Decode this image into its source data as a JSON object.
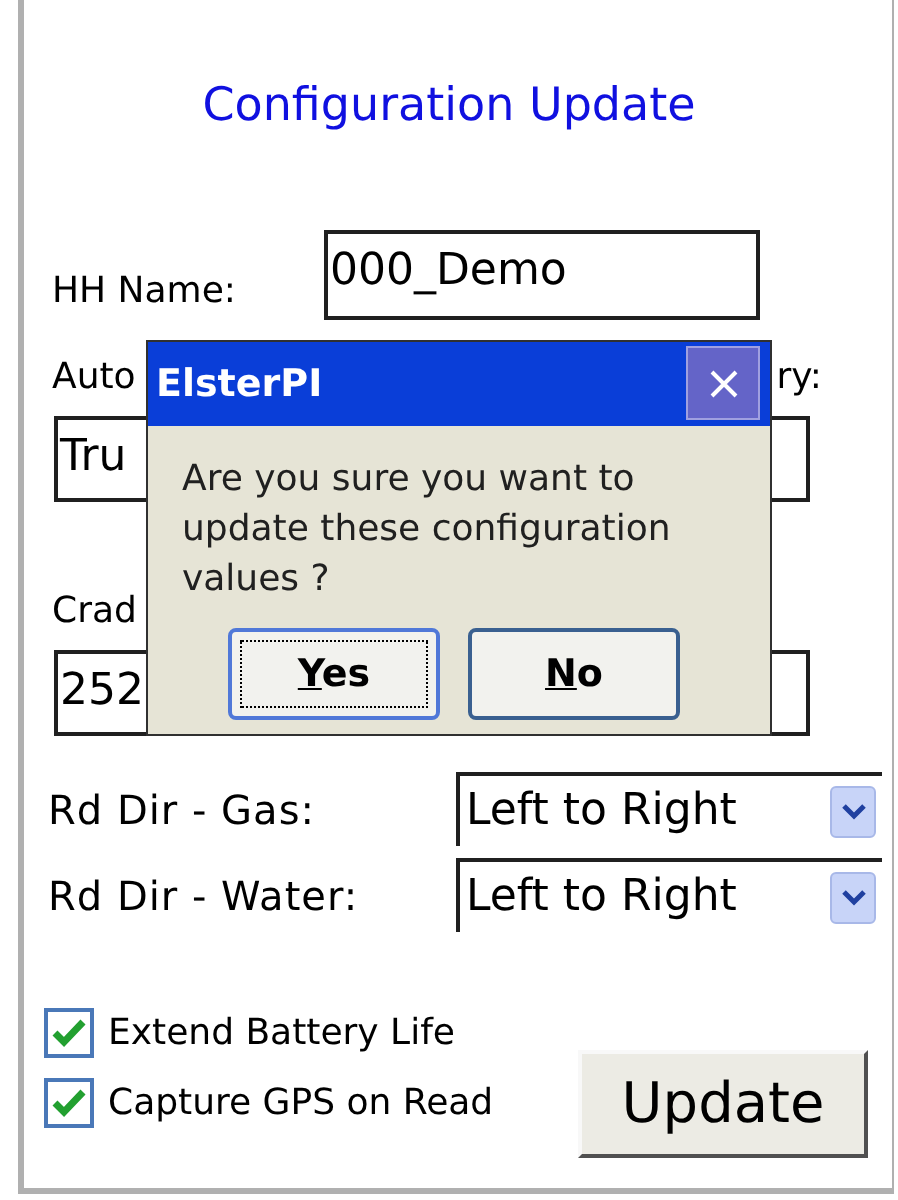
{
  "title": "Configuration Update",
  "hh_name": {
    "label": "HH Name:",
    "value": "000_Demo"
  },
  "fields": [
    {
      "label_left": "Auto",
      "label_right": "ry:",
      "value": "Tru"
    },
    {
      "label_left": "Crad",
      "value": "252"
    }
  ],
  "combos": [
    {
      "label": "Rd Dir - Gas:",
      "value": "Left to Right"
    },
    {
      "label": "Rd Dir - Water:",
      "value": "Left to Right"
    }
  ],
  "checkboxes": [
    {
      "label": "Extend Battery Life",
      "checked": true
    },
    {
      "label": "Capture GPS on Read",
      "checked": true
    }
  ],
  "update_button": "Update",
  "dialog": {
    "title": "ElsterPI",
    "message": "Are you sure you want to update these configuration values ?",
    "buttons": [
      {
        "label": "Yes",
        "focused": true
      },
      {
        "label": "No",
        "focused": false
      }
    ]
  }
}
